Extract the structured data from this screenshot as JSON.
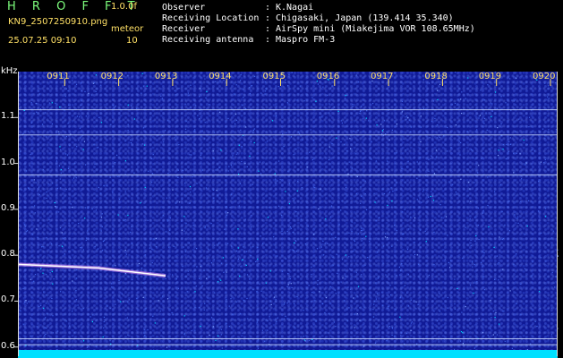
{
  "header": {
    "app_title": "H R O F F T",
    "version": "1.0.0f",
    "filename": "KN9_2507250910.png",
    "mode_label": "meteor",
    "datetime": "25.07.25 09:10",
    "mode_value": "10"
  },
  "metadata": [
    {
      "key": "Observer",
      "sep": ":",
      "value": "K.Nagai"
    },
    {
      "key": "Receiving Location",
      "sep": ":",
      "value": "Chigasaki, Japan (139.414 35.340)"
    },
    {
      "key": "Receiver",
      "sep": ":",
      "value": "AirSpy mini (Miakejima VOR 108.65MHz)"
    },
    {
      "key": "Receiving antenna",
      "sep": ":",
      "value": "Maspro FM-3"
    }
  ],
  "spectrogram": {
    "unit_label": "kHz",
    "time_ticks": [
      "0911",
      "0912",
      "0913",
      "0914",
      "0915",
      "0916",
      "0917",
      "0918",
      "0919",
      "0920"
    ],
    "freq_ticks": [
      1.1,
      1.0,
      0.9,
      0.8,
      0.7,
      0.6
    ],
    "freq_tick_labels": [
      "1.1",
      "1.0",
      "0.9",
      "0.8",
      "0.7",
      "0.6"
    ],
    "freq_range": [
      0.58,
      1.2
    ],
    "horizontal_lines_khz": [
      1.117,
      1.062,
      0.975,
      0.618,
      0.605
    ],
    "meteor_trail": {
      "time_start": "0910",
      "time_end": "0912.6",
      "freq_start_khz": 0.78,
      "freq_end_khz": 0.765
    },
    "colors": {
      "background": "#101a96",
      "noise": "#4060e0",
      "baseline": "#00e0ff",
      "label": "#ffe066",
      "title": "#7cfc7c"
    }
  }
}
